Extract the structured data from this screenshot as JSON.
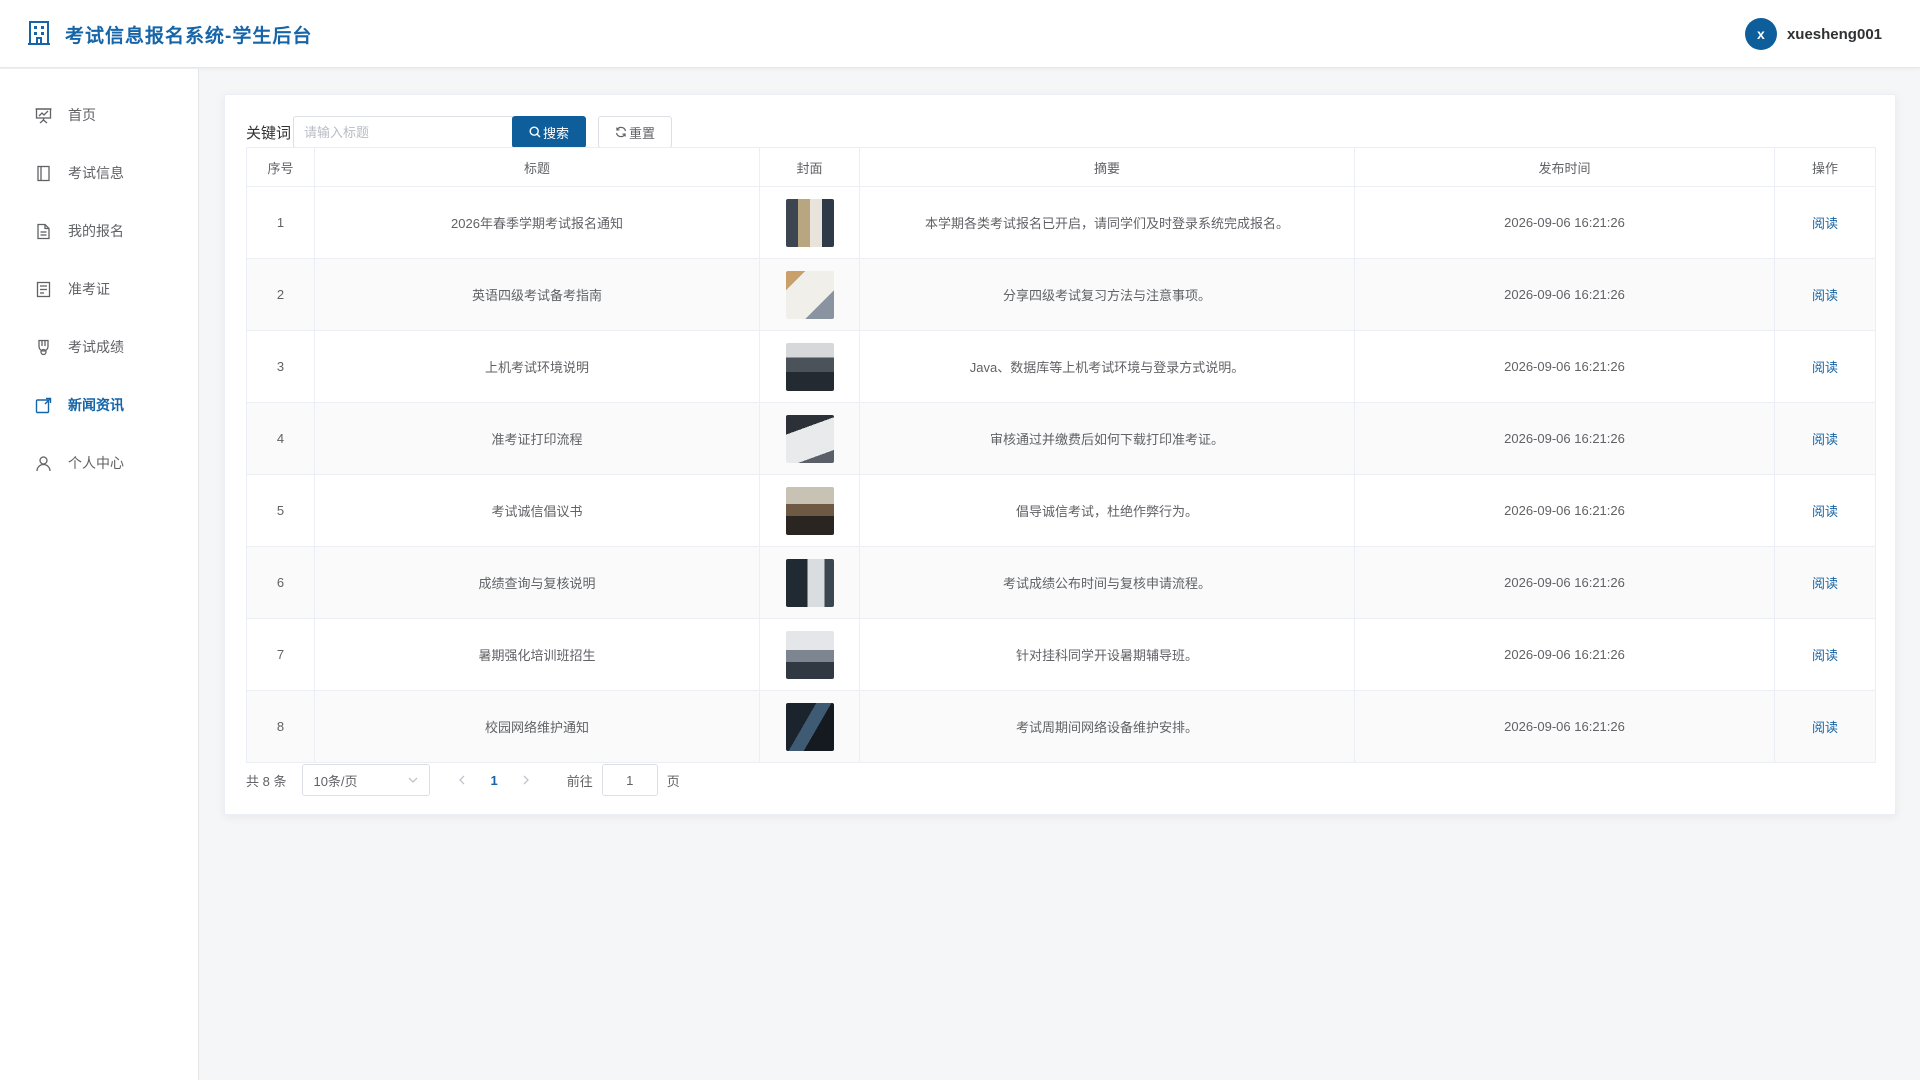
{
  "header": {
    "title": "考试信息报名系统-学生后台",
    "avatar_letter": "x",
    "username": "xuesheng001"
  },
  "sidebar": {
    "items": [
      {
        "label": "首页",
        "icon": "presentation-icon",
        "active": false
      },
      {
        "label": "考试信息",
        "icon": "book-icon",
        "active": false
      },
      {
        "label": "我的报名",
        "icon": "document-icon",
        "active": false
      },
      {
        "label": "准考证",
        "icon": "tickets-icon",
        "active": false
      },
      {
        "label": "考试成绩",
        "icon": "medal-icon",
        "active": false
      },
      {
        "label": "新闻资讯",
        "icon": "news-icon",
        "active": true
      },
      {
        "label": "个人中心",
        "icon": "user-icon",
        "active": false
      }
    ]
  },
  "search": {
    "label": "关键词",
    "placeholder": "请输入标题",
    "value": "",
    "search_button": "搜索",
    "reset_button": "重置"
  },
  "table": {
    "columns": [
      "序号",
      "标题",
      "封面",
      "摘要",
      "发布时间",
      "操作"
    ],
    "rows": [
      {
        "index": "1",
        "title": "2026年春季学期考试报名通知",
        "summary": "本学期各类考试报名已开启，请同学们及时登录系统完成报名。",
        "time": "2026-09-06 16:21:26",
        "action": "阅读"
      },
      {
        "index": "2",
        "title": "英语四级考试备考指南",
        "summary": "分享四级考试复习方法与注意事项。",
        "time": "2026-09-06 16:21:26",
        "action": "阅读"
      },
      {
        "index": "3",
        "title": "上机考试环境说明",
        "summary": "Java、数据库等上机考试环境与登录方式说明。",
        "time": "2026-09-06 16:21:26",
        "action": "阅读"
      },
      {
        "index": "4",
        "title": "准考证打印流程",
        "summary": "审核通过并缴费后如何下载打印准考证。",
        "time": "2026-09-06 16:21:26",
        "action": "阅读"
      },
      {
        "index": "5",
        "title": "考试诚信倡议书",
        "summary": "倡导诚信考试，杜绝作弊行为。",
        "time": "2026-09-06 16:21:26",
        "action": "阅读"
      },
      {
        "index": "6",
        "title": "成绩查询与复核说明",
        "summary": "考试成绩公布时间与复核申请流程。",
        "time": "2026-09-06 16:21:26",
        "action": "阅读"
      },
      {
        "index": "7",
        "title": "暑期强化培训班招生",
        "summary": "针对挂科同学开设暑期辅导班。",
        "time": "2026-09-06 16:21:26",
        "action": "阅读"
      },
      {
        "index": "8",
        "title": "校园网络维护通知",
        "summary": "考试周期间网络设备维护安排。",
        "time": "2026-09-06 16:21:26",
        "action": "阅读"
      }
    ]
  },
  "pagination": {
    "total_text": "共 8 条",
    "page_size": "10条/页",
    "current_page": "1",
    "goto_label": "前往",
    "goto_value": "1",
    "page_unit": "页"
  },
  "colors": {
    "primary": "#0f5e9c",
    "accent_text": "#1565a8"
  }
}
